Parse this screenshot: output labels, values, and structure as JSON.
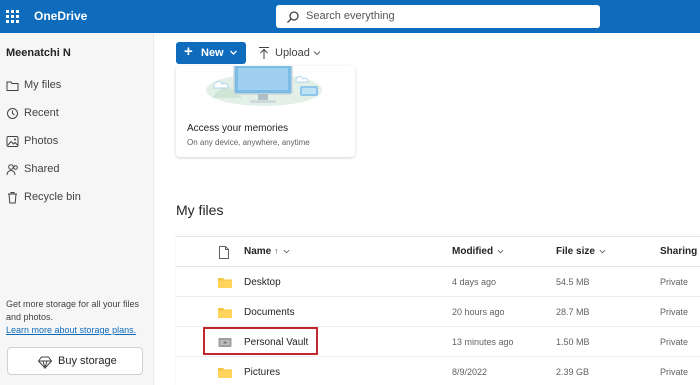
{
  "app": {
    "title": "OneDrive"
  },
  "search": {
    "placeholder": "Search everything"
  },
  "sidebar": {
    "user_name": "Meenatchi N",
    "items": [
      {
        "label": "My files",
        "icon": "folder-icon"
      },
      {
        "label": "Recent",
        "icon": "history-icon"
      },
      {
        "label": "Photos",
        "icon": "image-icon"
      },
      {
        "label": "Shared",
        "icon": "people-icon"
      },
      {
        "label": "Recycle bin",
        "icon": "trash-icon"
      }
    ],
    "storage_note": "Get more storage for all your files and photos.",
    "storage_link": "Learn more about storage plans.",
    "buy_label": "Buy storage"
  },
  "toolbar": {
    "new_label": "New",
    "upload_label": "Upload"
  },
  "card": {
    "title": "Access your memories",
    "subtitle": "On any device, anywhere, anytime"
  },
  "main": {
    "heading": "My files"
  },
  "table": {
    "columns": {
      "name": "Name",
      "sort_arrow": "↑",
      "modified": "Modified",
      "size": "File size",
      "sharing": "Sharing"
    },
    "rows": [
      {
        "name": "Desktop",
        "modified": "4 days ago",
        "size": "54.5 MB",
        "sharing": "Private",
        "icon": "folder-icon"
      },
      {
        "name": "Documents",
        "modified": "20 hours ago",
        "size": "28.7 MB",
        "sharing": "Private",
        "icon": "folder-icon"
      },
      {
        "name": "Personal Vault",
        "modified": "13 minutes ago",
        "size": "1.50 MB",
        "sharing": "Private",
        "icon": "vault-icon"
      },
      {
        "name": "Pictures",
        "modified": "8/9/2022",
        "size": "2.39 GB",
        "sharing": "Private",
        "icon": "folder-icon"
      }
    ]
  },
  "colors": {
    "brand": "#0f6cbd",
    "folder": "#f4c542",
    "highlight": "#c0282d"
  }
}
